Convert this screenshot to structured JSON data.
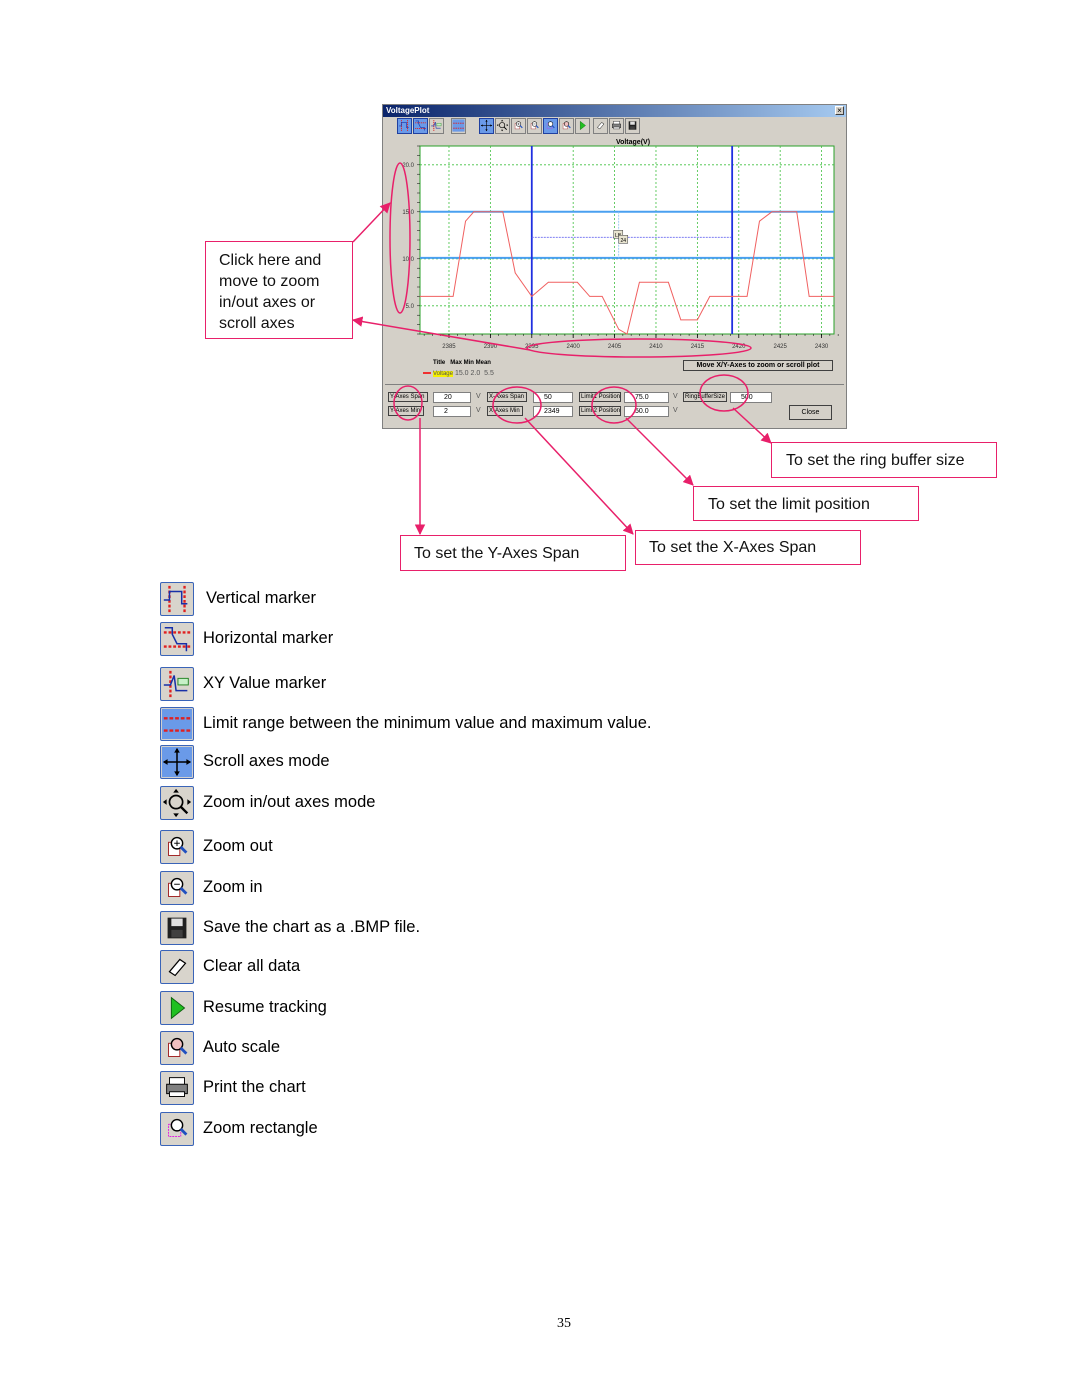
{
  "window": {
    "title": "VoltagePlot",
    "close_glyph": "×",
    "toolbar": [
      {
        "name": "vertical-marker-icon",
        "active": true
      },
      {
        "name": "horizontal-marker-icon",
        "active": true
      },
      {
        "name": "xy-value-marker-icon",
        "active": false
      },
      {
        "name": "limit-range-icon",
        "active": false
      },
      {
        "name": "scroll-axes-icon",
        "active": true
      },
      {
        "name": "zoom-axes-mode-icon",
        "active": false
      },
      {
        "name": "zoom-out-icon",
        "active": false
      },
      {
        "name": "zoom-in-icon",
        "active": false
      },
      {
        "name": "zoom-rectangle-icon",
        "active": true
      },
      {
        "name": "auto-scale-icon",
        "active": false
      },
      {
        "name": "resume-tracking-icon",
        "active": false
      },
      {
        "name": "clear-data-icon",
        "active": false
      },
      {
        "name": "print-icon",
        "active": false
      },
      {
        "name": "save-bmp-icon",
        "active": false
      }
    ],
    "legend": {
      "headers": [
        "Title",
        "Max",
        "Min",
        "Mean"
      ],
      "series_name": "Voltage",
      "max": "15.0",
      "min": "2.0",
      "mean": "5.5"
    },
    "hint_box": "Move X/Y-Axes to zoom or scroll plot",
    "controls": {
      "y_axes_span_label": "Y-Axes Span",
      "y_axes_span_value": "20",
      "y_axes_span_unit": "V",
      "y_axes_min_label": "Y-Axes Min",
      "y_axes_min_value": "2",
      "y_axes_min_unit": "V",
      "x_axes_span_label": "X-Axes Span",
      "x_axes_span_value": "50",
      "x_axes_min_label": "X-Axes Min",
      "x_axes_min_value": "2349",
      "limit1_label": "Limit1 Position",
      "limit1_value": "75.0",
      "limit1_unit": "V",
      "limit2_label": "Limit2 Position",
      "limit2_value": "50.0",
      "limit2_unit": "V",
      "ring_buffer_label": "RingBufferSize",
      "ring_buffer_value": "500",
      "close_label": "Close"
    },
    "marker_tags": [
      "LB",
      "24"
    ]
  },
  "chart_data": {
    "type": "line",
    "title": "Voltage(V)",
    "xlabel": "",
    "ylabel": "",
    "xlim": [
      2381.5,
      2431.5
    ],
    "ylim": [
      2.0,
      22.0
    ],
    "x_ticks": [
      2385,
      2390,
      2395,
      2400,
      2405,
      2410,
      2415,
      2420,
      2425,
      2430
    ],
    "y_ticks": [
      5.0,
      10.0,
      15.0,
      20.0
    ],
    "y_tick_labels": [
      "5.0",
      "10.0",
      "15.0",
      "20.0"
    ],
    "grid": true,
    "legend_position": "bottom-left",
    "series": [
      {
        "name": "Voltage",
        "color": "#f06060",
        "x": [
          2381.5,
          2385.5,
          2387,
          2388,
          2391.5,
          2393,
          2395,
          2397,
          2400.5,
          2402,
          2403.5,
          2405.5,
          2406.5,
          2408,
          2411.5,
          2413,
          2415,
          2416.5,
          2421,
          2422.5,
          2424,
          2427,
          2428.5,
          2431.5
        ],
        "y": [
          6.0,
          6.0,
          14.0,
          15.0,
          15.0,
          8.5,
          6.0,
          7.5,
          7.5,
          6.0,
          6.0,
          2.5,
          2.0,
          7.5,
          7.5,
          3.5,
          3.5,
          6.0,
          6.0,
          14.0,
          15.0,
          15.0,
          6.0,
          6.0
        ]
      }
    ],
    "vertical_markers": [
      2395,
      2419.2
    ],
    "limit_lines": [
      15.0,
      10.1
    ],
    "xy_marker": {
      "x": 2405.5,
      "y": 12.5
    }
  },
  "callouts": {
    "zoom_axes": "Click here and move to zoom in/out axes or scroll axes",
    "ring_buffer": "To set the ring buffer size",
    "limit_position": "To set the limit position",
    "y_span": "To set the Y-Axes Span",
    "x_span": "To set the X-Axes Span"
  },
  "icon_legend": [
    {
      "icon": "vertical-marker-icon",
      "label": "Vertical marker"
    },
    {
      "icon": "horizontal-marker-icon",
      "label": "Horizontal marker"
    },
    {
      "icon": "xy-value-marker-icon",
      "label": "XY Value marker"
    },
    {
      "icon": "limit-range-icon",
      "label": "Limit range between the minimum value and maximum value."
    },
    {
      "icon": "scroll-axes-icon",
      "label": "Scroll axes mode"
    },
    {
      "icon": "zoom-axes-mode-icon",
      "label": "Zoom in/out axes mode"
    },
    {
      "icon": "zoom-out-icon",
      "label": "Zoom out"
    },
    {
      "icon": "zoom-in-icon",
      "label": "Zoom in"
    },
    {
      "icon": "save-bmp-icon",
      "label": "Save the chart as a .BMP file."
    },
    {
      "icon": "clear-data-icon",
      "label": "Clear all data"
    },
    {
      "icon": "resume-tracking-icon",
      "label": "Resume tracking"
    },
    {
      "icon": "auto-scale-icon",
      "label": "Auto scale"
    },
    {
      "icon": "print-icon",
      "label": "Print the chart"
    },
    {
      "icon": "zoom-rectangle-icon",
      "label": "Zoom rectangle"
    }
  ],
  "page_number": "35"
}
